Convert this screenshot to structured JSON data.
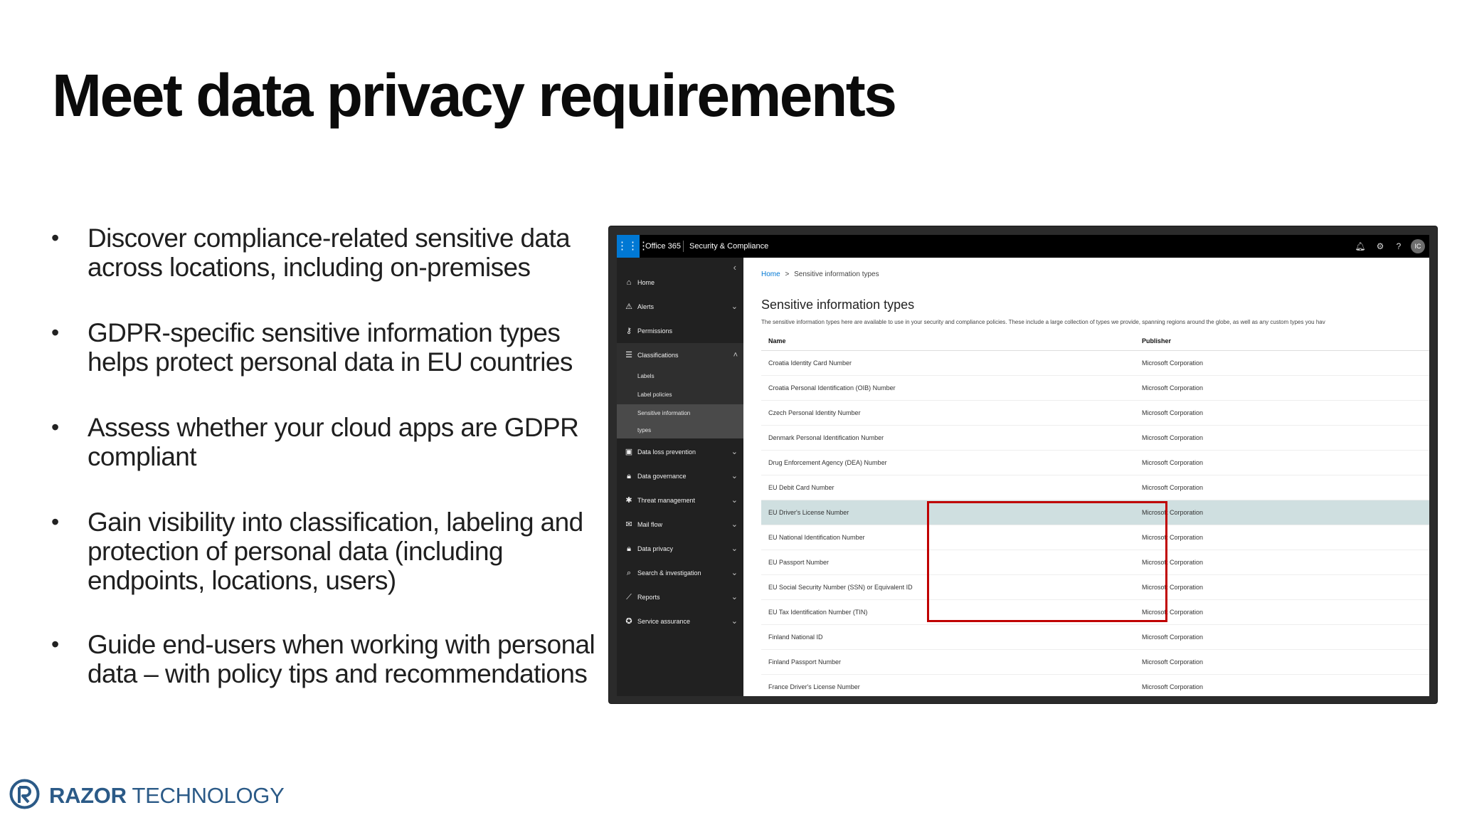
{
  "slide": {
    "title": "Meet data privacy requirements",
    "bullets": [
      "Discover compliance-related sensitive data across locations, including on-premises",
      "GDPR-specific sensitive information types helps protect personal data in EU countries",
      "Assess whether your cloud apps are GDPR compliant",
      "Gain visibility into classification, labeling and protection of personal data (including endpoints, locations, users)",
      "Guide end-users when working with personal data – with policy tips and recommendations"
    ]
  },
  "app": {
    "brand": "Office 365",
    "product": "Security & Compliance",
    "avatar": "IC",
    "nav": [
      {
        "label": "Home",
        "icon": "home-icon"
      },
      {
        "label": "Alerts",
        "icon": "alert-icon"
      },
      {
        "label": "Permissions",
        "icon": "permissions-icon"
      },
      {
        "label": "Classifications",
        "icon": "list-icon"
      },
      {
        "label": "Data loss prevention",
        "icon": "document-lock-icon"
      },
      {
        "label": "Data governance",
        "icon": "lock-icon"
      },
      {
        "label": "Threat management",
        "icon": "bug-icon"
      },
      {
        "label": "Mail flow",
        "icon": "mail-icon"
      },
      {
        "label": "Data privacy",
        "icon": "lock-icon"
      },
      {
        "label": "Search & investigation",
        "icon": "search-icon"
      },
      {
        "label": "Reports",
        "icon": "chart-icon"
      },
      {
        "label": "Service assurance",
        "icon": "ribbon-icon"
      }
    ],
    "subnav": [
      "Labels",
      "Label policies",
      "Sensitive information",
      "types"
    ],
    "breadcrumb": {
      "home": "Home",
      "separator": ">",
      "current": "Sensitive information types"
    },
    "page_title": "Sensitive information types",
    "description": "The sensitive information types here are available to use in your security and compliance policies. These include a large collection of types we provide, spanning regions around the globe, as well as any custom types you hav",
    "table": {
      "headers": [
        "Name",
        "Publisher"
      ],
      "rows": [
        [
          "Croatia Identity Card Number",
          "Microsoft Corporation"
        ],
        [
          "Croatia Personal Identification (OIB) Number",
          "Microsoft Corporation"
        ],
        [
          "Czech Personal Identity Number",
          "Microsoft Corporation"
        ],
        [
          "Denmark Personal Identification Number",
          "Microsoft Corporation"
        ],
        [
          "Drug Enforcement Agency (DEA) Number",
          "Microsoft Corporation"
        ],
        [
          "EU Debit Card Number",
          "Microsoft Corporation"
        ],
        [
          "EU Driver's License Number",
          "Microsoft Corporation"
        ],
        [
          "EU National Identification Number",
          "Microsoft Corporation"
        ],
        [
          "EU Passport Number",
          "Microsoft Corporation"
        ],
        [
          "EU Social Security Number (SSN) or Equivalent ID",
          "Microsoft Corporation"
        ],
        [
          "EU Tax Identification Number (TIN)",
          "Microsoft Corporation"
        ],
        [
          "Finland National ID",
          "Microsoft Corporation"
        ],
        [
          "Finland Passport Number",
          "Microsoft Corporation"
        ],
        [
          "France Driver's License Number",
          "Microsoft Corporation"
        ]
      ]
    }
  },
  "logo": {
    "bold": "RAZOR",
    "light": " TECHNOLOGY"
  },
  "colors": {
    "accent": "#0078d4",
    "highlight": "#c00000",
    "selected_row": "#cfdfe0",
    "logo": "#2b5a87"
  }
}
